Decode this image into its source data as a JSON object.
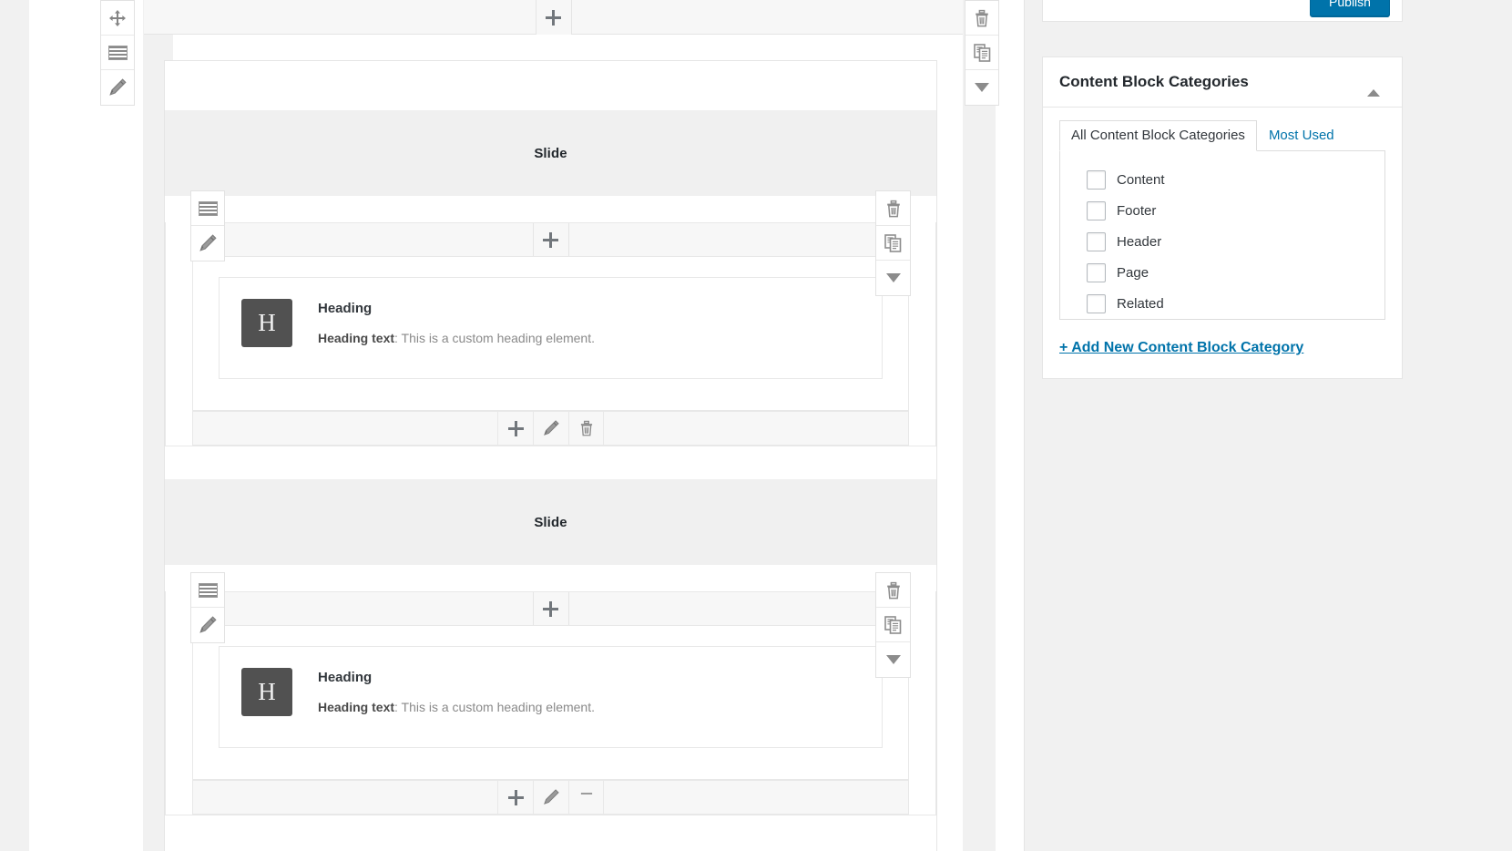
{
  "editor": {
    "outer_toolbar_left": [
      {
        "name": "move-icon",
        "label": "Move"
      },
      {
        "name": "lines-icon",
        "label": "Settings"
      },
      {
        "name": "pencil-icon",
        "label": "Edit"
      }
    ],
    "outer_toolbar_right": [
      {
        "name": "trash-icon",
        "label": "Delete"
      },
      {
        "name": "duplicate-icon",
        "label": "Duplicate"
      },
      {
        "name": "caret-down-icon",
        "label": "Collapse"
      }
    ],
    "add_button_label": "+",
    "element_footer_buttons": [
      {
        "name": "plus-icon",
        "label": "+"
      },
      {
        "name": "pencil-icon",
        "label": "Edit"
      },
      {
        "name": "trash-icon",
        "label": "Delete"
      }
    ],
    "slides": [
      {
        "title": "Slide",
        "element": {
          "icon_letter": "H",
          "title": "Heading",
          "desc_label": "Heading text",
          "desc_sep": ": ",
          "desc_value": "This is a custom heading element."
        }
      },
      {
        "title": "Slide",
        "element": {
          "icon_letter": "H",
          "title": "Heading",
          "desc_label": "Heading text",
          "desc_sep": ": ",
          "desc_value": "This is a custom heading element."
        }
      }
    ]
  },
  "sidebar": {
    "publish": {
      "label": "Publish"
    },
    "categories_box": {
      "title": "Content Block Categories",
      "toggle_icon": "caret-up-icon",
      "tabs": [
        {
          "label": "All Content Block Categories",
          "active": true
        },
        {
          "label": "Most Used",
          "active": false
        }
      ],
      "items": [
        {
          "label": "Content",
          "checked": false
        },
        {
          "label": "Footer",
          "checked": false
        },
        {
          "label": "Header",
          "checked": false
        },
        {
          "label": "Page",
          "checked": false
        },
        {
          "label": "Related",
          "checked": false
        }
      ],
      "add_link": "+ Add New Content Block Category"
    }
  },
  "colors": {
    "accent": "#0073aa",
    "link": "#0073aa",
    "icon_tile_bg": "#515151",
    "panel_bg": "#f1f1f1",
    "bar_bg": "#f7f7f7",
    "slide_header_bg": "#f0f0f0"
  }
}
